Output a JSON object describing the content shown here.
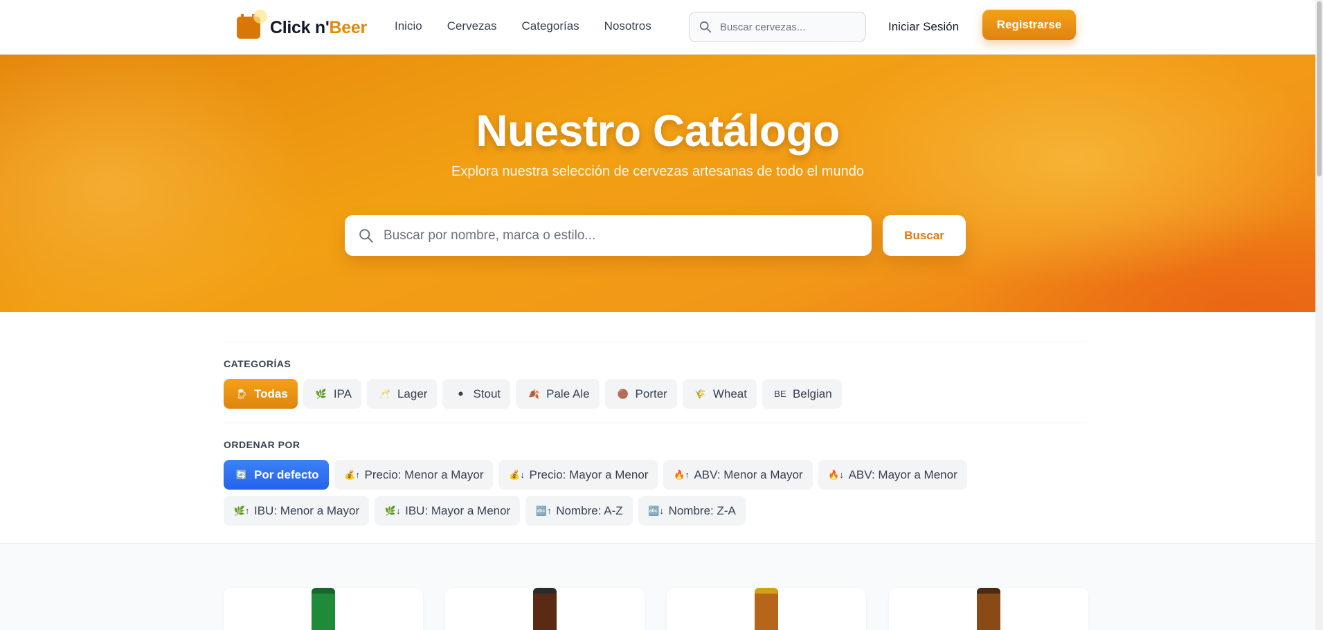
{
  "brand": {
    "name_main": "Click n'",
    "name_accent": "Beer",
    "accent_color": "#e08a0c"
  },
  "nav": {
    "items": [
      "Inicio",
      "Cervezas",
      "Categorías",
      "Nosotros"
    ]
  },
  "header_search": {
    "placeholder": "Buscar cervezas..."
  },
  "auth": {
    "login": "Iniciar Sesión",
    "register": "Registrarse"
  },
  "hero": {
    "title": "Nuestro Catálogo",
    "subtitle": "Explora nuestra selección de cervezas artesanas de todo el mundo",
    "search_placeholder": "Buscar por nombre, marca o estilo...",
    "search_button": "Buscar"
  },
  "categories": {
    "label": "CATEGORÍAS",
    "items": [
      {
        "icon": "🍺",
        "label": "Todas",
        "active": true
      },
      {
        "icon": "🌿",
        "label": "IPA"
      },
      {
        "icon": "🥂",
        "label": "Lager"
      },
      {
        "icon": "⚫",
        "label": "Stout"
      },
      {
        "icon": "🍂",
        "label": "Pale Ale"
      },
      {
        "icon": "🟤",
        "label": "Porter"
      },
      {
        "icon": "🌾",
        "label": "Wheat"
      },
      {
        "icon": "BE",
        "label": "Belgian"
      }
    ]
  },
  "sort": {
    "label": "ORDENAR POR",
    "row1": [
      {
        "icon": "🔄",
        "label": "Por defecto",
        "active": true
      },
      {
        "icon": "💰↑",
        "label": "Precio: Menor a Mayor"
      },
      {
        "icon": "💰↓",
        "label": "Precio: Mayor a Menor"
      },
      {
        "icon": "🔥↑",
        "label": "ABV: Menor a Mayor"
      },
      {
        "icon": "🔥↓",
        "label": "ABV: Mayor a Menor"
      }
    ],
    "row2": [
      {
        "icon": "🌿↑",
        "label": "IBU: Menor a Mayor"
      },
      {
        "icon": "🌿↓",
        "label": "IBU: Mayor a Menor"
      },
      {
        "icon": "🔤↑",
        "label": "Nombre: A-Z"
      },
      {
        "icon": "🔤↓",
        "label": "Nombre: Z-A"
      }
    ]
  },
  "products": [
    {
      "bottle_color": "#1f8a3a",
      "cap_color": "#16672b"
    },
    {
      "bottle_color": "#5a2a14",
      "cap_color": "#2b2b2b"
    },
    {
      "bottle_color": "#b7651a",
      "cap_color": "#d4a017"
    },
    {
      "bottle_color": "#8a4a16",
      "cap_color": "#4a2a10"
    }
  ]
}
